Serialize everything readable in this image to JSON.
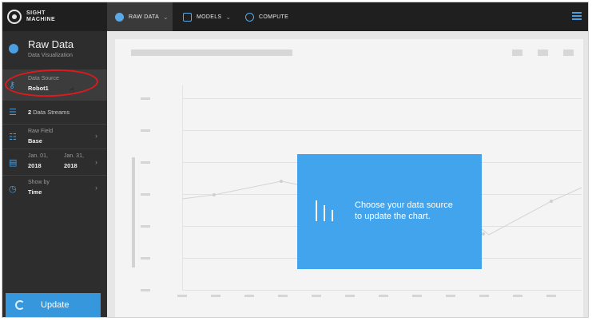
{
  "brand": {
    "line1": "SIGHT",
    "line2": "MACHINE"
  },
  "nav": {
    "tabs": [
      {
        "label": "RAW DATA",
        "icon": "raw-data-icon"
      },
      {
        "label": "MODELS",
        "icon": "models-icon"
      },
      {
        "label": "COMPUTE",
        "icon": "compute-icon"
      }
    ],
    "menu_icon": "hamburger-menu-icon"
  },
  "sidebar": {
    "title": "Raw Data",
    "subtitle": "Data Visualization",
    "data_source": {
      "label": "Data Source",
      "value": "Robot1"
    },
    "streams": {
      "count": "2",
      "label": "Data Streams"
    },
    "raw_field": {
      "label": "Raw Field",
      "value": "Base"
    },
    "date_range": {
      "start_label": "Jan. 01,",
      "start_year": "2018",
      "end_label": "Jan. 31,",
      "end_year": "2018"
    },
    "show_by": {
      "label": "Show by",
      "value": "Time"
    },
    "update_label": "Update"
  },
  "overlay": {
    "line1": "Choose your data source",
    "line2": "to update the chart."
  },
  "colors": {
    "accent": "#3797dc",
    "overlay": "#43a4ee",
    "sidebar": "#2d2d2d",
    "topbar": "#1f1f1f",
    "annotation": "#e0191f"
  }
}
